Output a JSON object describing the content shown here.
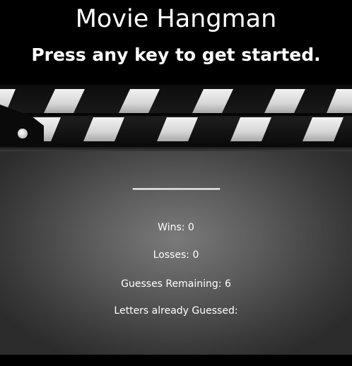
{
  "header": {
    "title": "Movie Hangman",
    "subtitle": "Press any key to get started."
  },
  "game": {
    "word_display": "__________",
    "wins_label": "Wins:",
    "wins_value": "0",
    "losses_label": "Losses:",
    "losses_value": "0",
    "remaining_label": "Guesses Remaining:",
    "remaining_value": "6",
    "guessed_label": "Letters already Guessed:",
    "guessed_value": ""
  },
  "colors": {
    "page_background": "#000000",
    "text": "#ffffff",
    "clapper_stripe": "#d9d9d9",
    "board": "#5a5a5a"
  }
}
